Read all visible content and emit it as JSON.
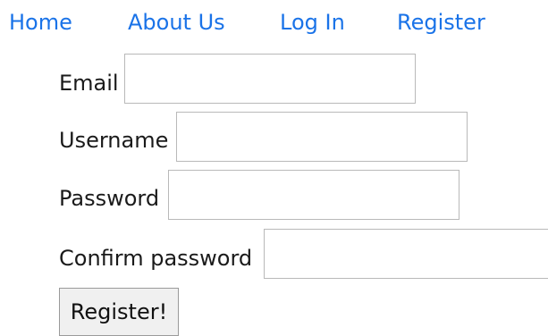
{
  "nav": {
    "home": "Home",
    "about": "About Us",
    "login": "Log In",
    "register": "Register"
  },
  "form": {
    "email_label": "Email",
    "email_value": "",
    "username_label": "Username",
    "username_value": "",
    "password_label": "Password",
    "password_value": "",
    "confirm_label": "Confirm password",
    "confirm_value": "",
    "submit_label": "Register!"
  },
  "colors": {
    "link": "#1a73e8",
    "text": "#1a1a1a",
    "border": "#b9b9b9",
    "button_bg": "#f0f0f0"
  }
}
